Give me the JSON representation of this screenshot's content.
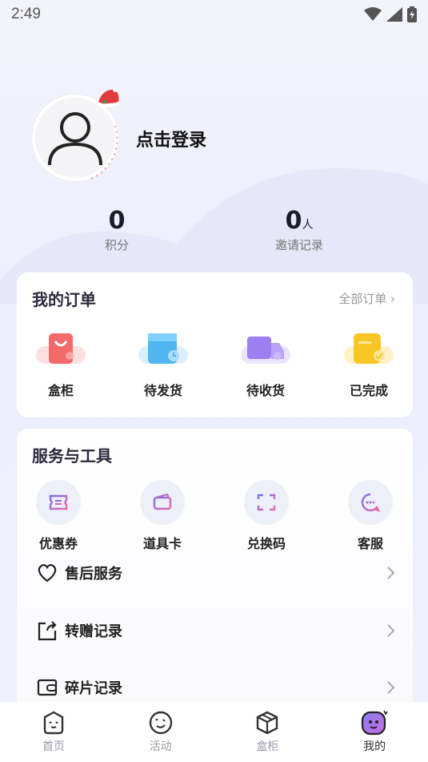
{
  "status_bar": {
    "time": "2:49"
  },
  "profile": {
    "login_label": "点击登录"
  },
  "stats": [
    {
      "value": "0",
      "unit": "",
      "label": "积分"
    },
    {
      "value": "0",
      "unit": "人",
      "label": "邀请记录"
    }
  ],
  "orders": {
    "title": "我的订单",
    "more_label": "全部订单 ›",
    "items": [
      {
        "label": "盒柜",
        "icon": "box-cabinet-icon",
        "color": "#f46a6a"
      },
      {
        "label": "待发货",
        "icon": "pending-ship-icon",
        "color": "#4fb6f0"
      },
      {
        "label": "待收货",
        "icon": "truck-icon",
        "color": "#9c7ff0"
      },
      {
        "label": "已完成",
        "icon": "completed-icon",
        "color": "#f8c524"
      }
    ]
  },
  "tools": {
    "title": "服务与工具",
    "items": [
      {
        "label": "优惠券",
        "icon": "coupon-icon"
      },
      {
        "label": "道具卡",
        "icon": "card-icon"
      },
      {
        "label": "兑换码",
        "icon": "scan-code-icon"
      },
      {
        "label": "客服",
        "icon": "customer-service-icon"
      }
    ],
    "menu": [
      {
        "label": "售后服务",
        "icon": "heart-icon"
      },
      {
        "label": "转赠记录",
        "icon": "share-icon"
      },
      {
        "label": "碎片记录",
        "icon": "wallet-icon"
      }
    ]
  },
  "tabbar": [
    {
      "label": "首页",
      "icon": "home-face-icon",
      "active": false
    },
    {
      "label": "活动",
      "icon": "activity-face-icon",
      "active": false
    },
    {
      "label": "盒柜",
      "icon": "cube-icon",
      "active": false
    },
    {
      "label": "我的",
      "icon": "mine-face-icon",
      "active": true
    }
  ],
  "colors": {
    "accent": "#7c6cf0",
    "card_bg": "#ffffff",
    "page_bg": "#eceefb"
  }
}
